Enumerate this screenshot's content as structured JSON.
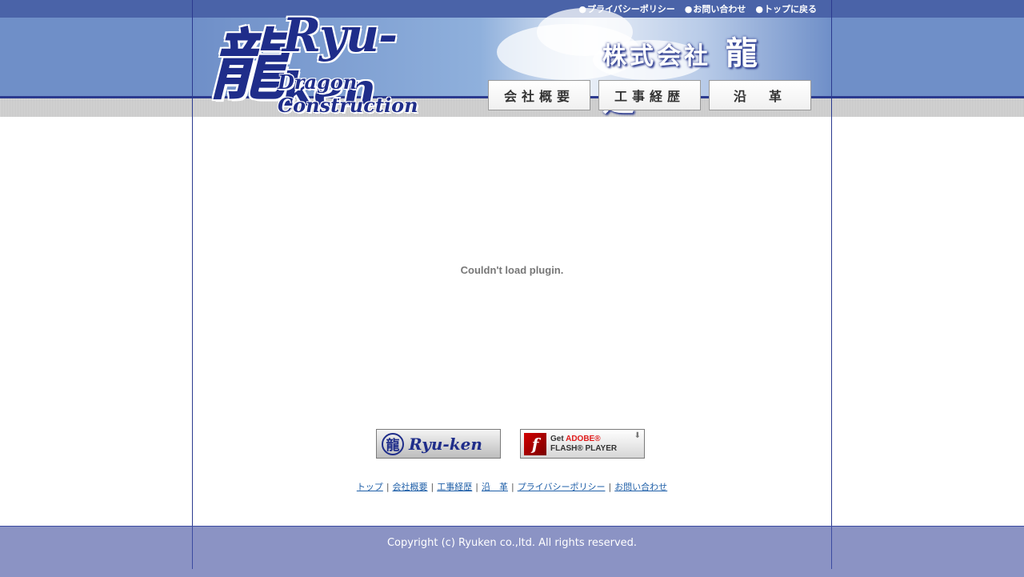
{
  "header": {
    "logo_kanji": "龍",
    "logo_name": "Ryu-ken",
    "logo_sub": "Dragon Construction",
    "top_links": [
      "プライバシーポリシー",
      "お問い合わせ",
      "トップに戻る"
    ],
    "company_prefix": "株式会社",
    "company_name": "龍建",
    "nav": [
      "会社概要",
      "工事経歴",
      "沿　革"
    ]
  },
  "main": {
    "plugin_message": "Couldn't load plugin."
  },
  "banners": {
    "ryuken_seal": "龍",
    "ryuken_text": "Ryu-ken",
    "flash_icon": "f",
    "flash_get": "Get",
    "flash_adobe": "ADOBE®",
    "flash_player": "FLASH® PLAYER"
  },
  "footer_links": [
    "トップ",
    "会社概要",
    "工事経歴",
    "沿　革",
    "プライバシーポリシー",
    "お問い合わせ"
  ],
  "copyright": "Copyright (c) Ryuken co.,ltd. All rights reserved.",
  "colors": {
    "navy": "#1f2d8a",
    "header_blue": "#6f8fc8",
    "footer": "#8b93c4",
    "link": "#1f5fa8"
  }
}
